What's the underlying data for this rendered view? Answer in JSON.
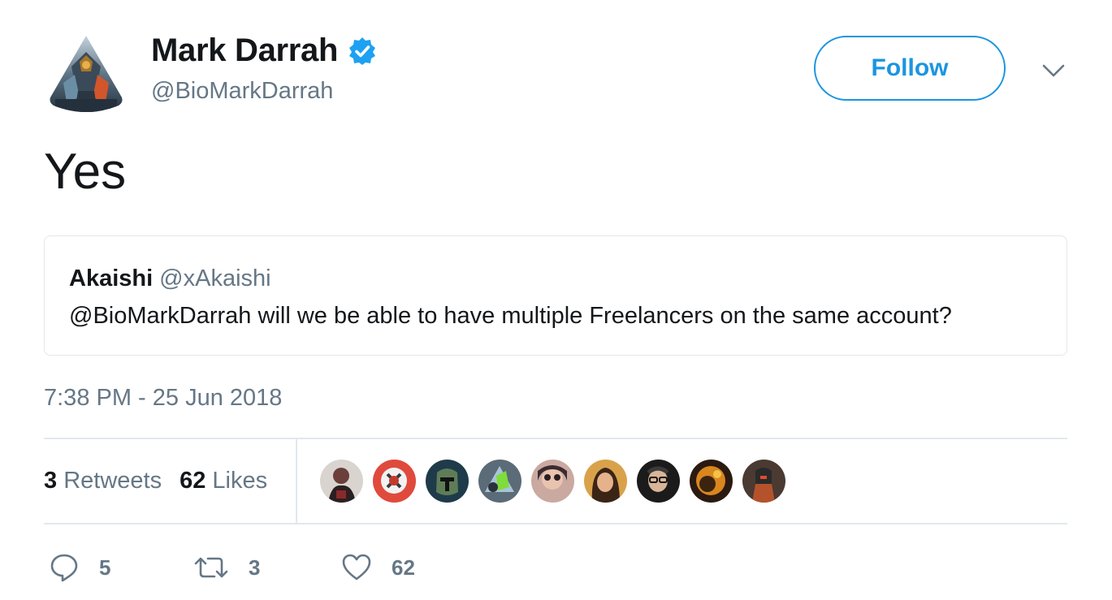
{
  "author": {
    "name": "Mark Darrah",
    "handle": "@BioMarkDarrah",
    "verified": true
  },
  "follow_label": "Follow",
  "tweet_text": "Yes",
  "quoted": {
    "name": "Akaishi",
    "handle": "@xAkaishi",
    "text": "@BioMarkDarrah will we be able to have multiple Freelancers on the same account?"
  },
  "timestamp": "7:38 PM - 25 Jun 2018",
  "stats": {
    "retweets_count": "3",
    "retweets_label": "Retweets",
    "likes_count": "62",
    "likes_label": "Likes"
  },
  "likers": [
    "liker-1",
    "liker-2",
    "liker-3",
    "liker-4",
    "liker-5",
    "liker-6",
    "liker-7",
    "liker-8",
    "liker-9"
  ],
  "actions": {
    "reply_count": "5",
    "retweet_count": "3",
    "like_count": "62"
  },
  "colors": {
    "accent": "#1b95e0",
    "muted": "#657786",
    "border": "#e1e8ed",
    "verified": "#1da1f2"
  }
}
